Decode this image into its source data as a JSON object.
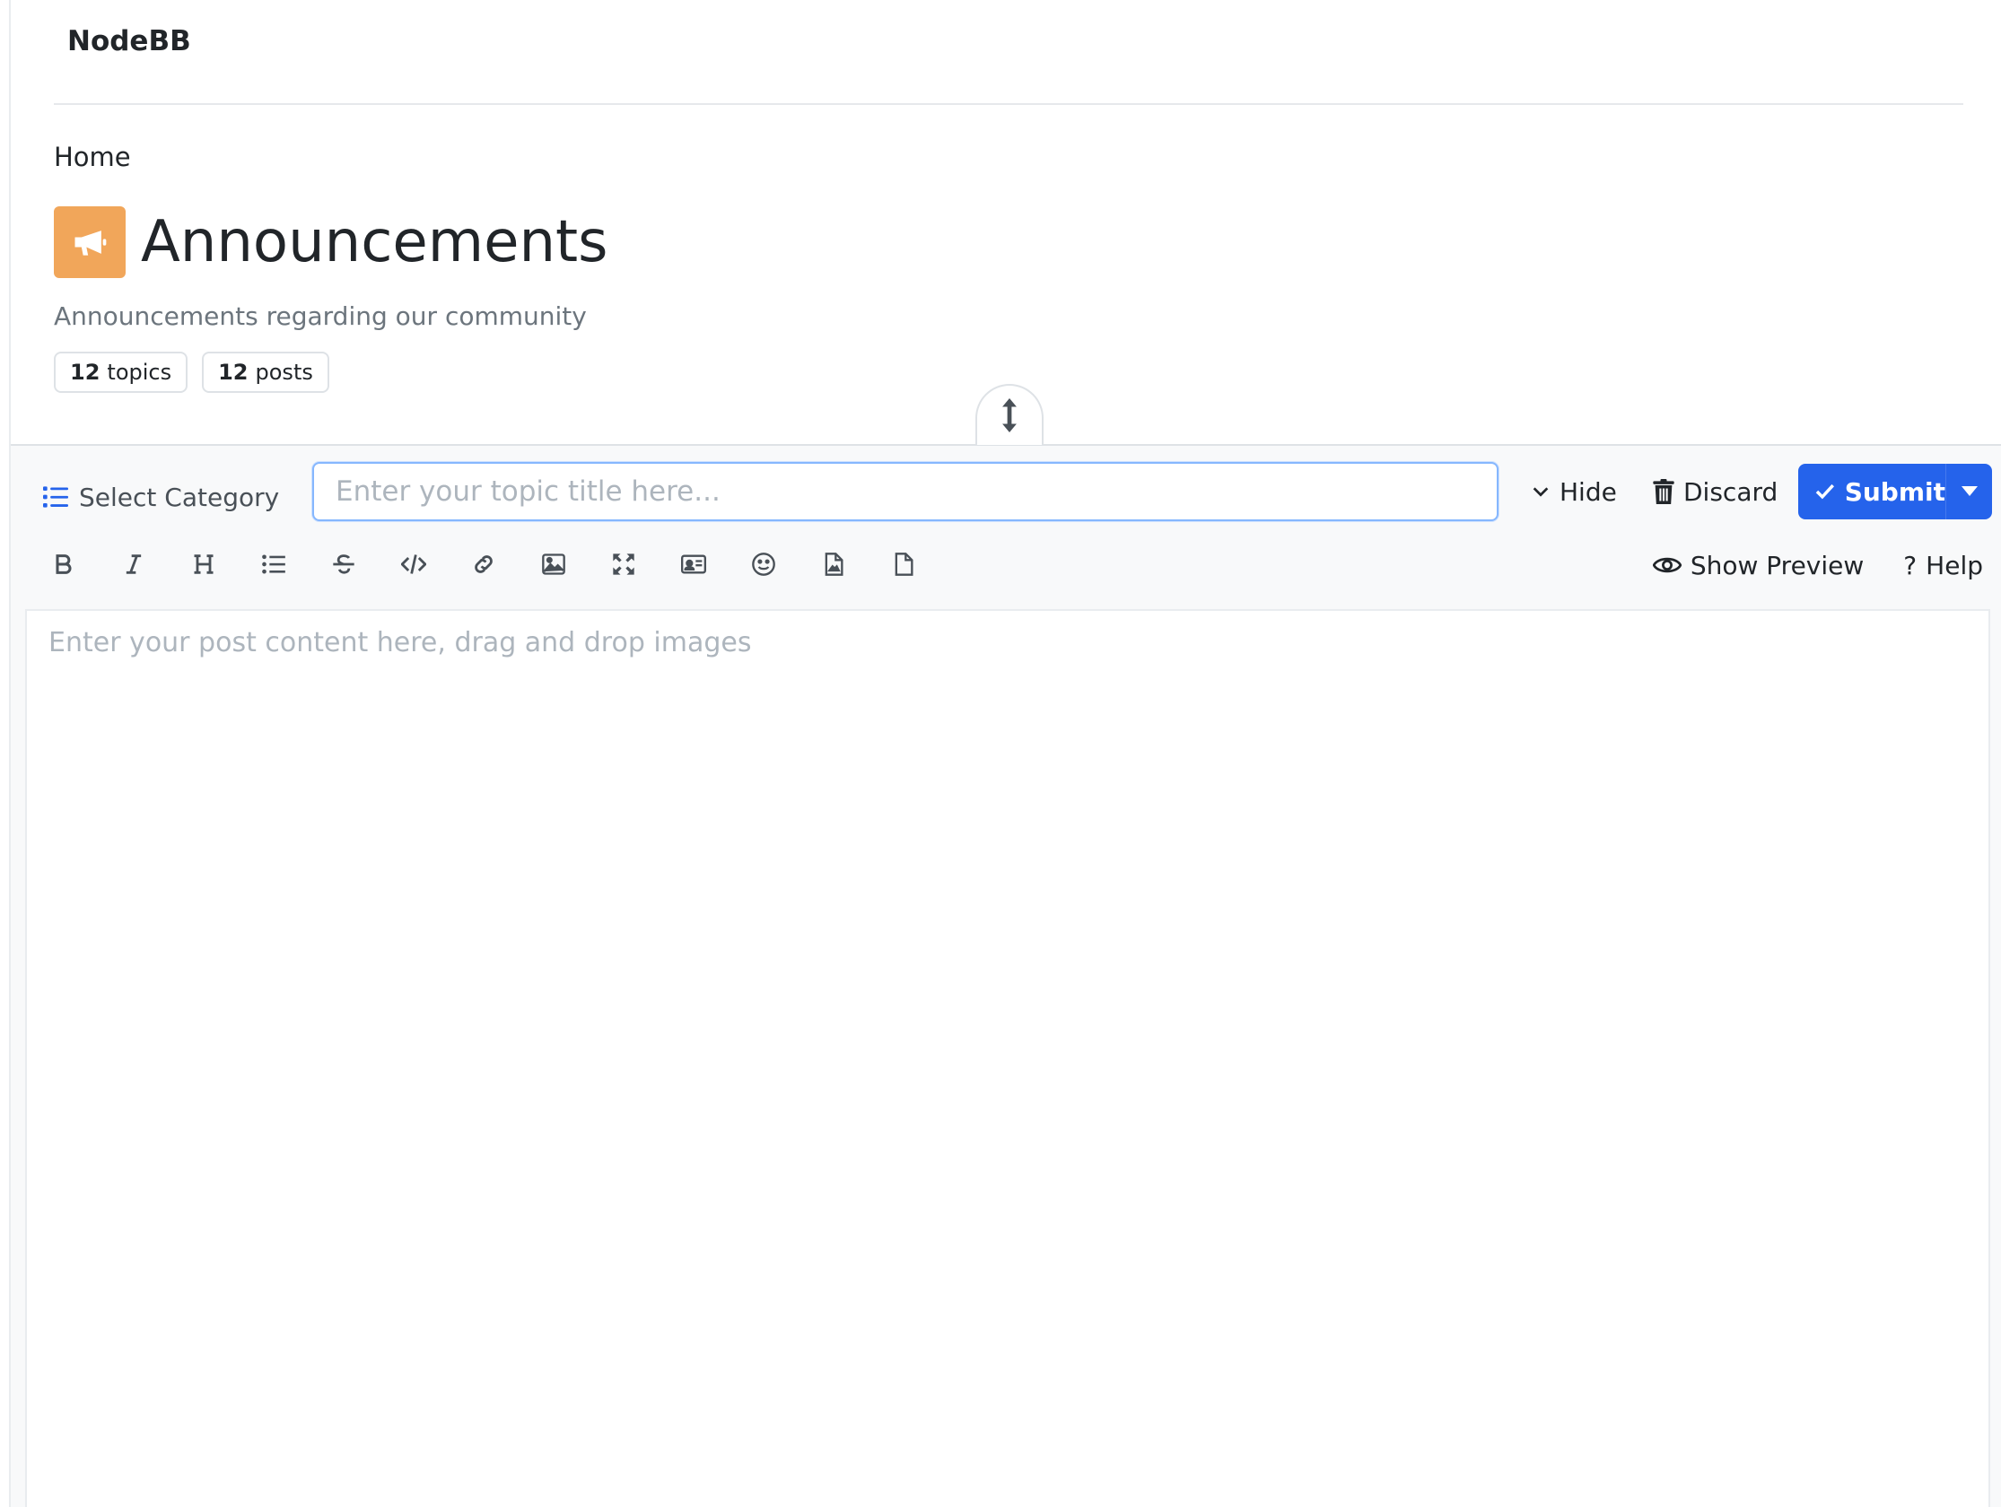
{
  "header": {
    "brand": "NodeBB"
  },
  "breadcrumb": {
    "home": "Home"
  },
  "category": {
    "title": "Announcements",
    "description": "Announcements regarding our community",
    "icon": "bullhorn-icon",
    "icon_color": "#f1a65a",
    "stats": [
      {
        "count": "12",
        "label": "topics"
      },
      {
        "count": "12",
        "label": "posts"
      }
    ]
  },
  "composer": {
    "category_select_label": "Select Category",
    "title_placeholder": "Enter your topic title here...",
    "hide_label": "Hide",
    "discard_label": "Discard",
    "submit_label": "Submit",
    "submit_color": "#2563eb",
    "content_placeholder": "Enter your post content here, drag and drop images",
    "toolbar": [
      "bold-icon",
      "italic-icon",
      "heading-icon",
      "list-icon",
      "strikethrough-icon",
      "code-icon",
      "link-icon",
      "image-icon",
      "zen-mode-icon",
      "user-card-icon",
      "emoji-icon",
      "file-image-icon",
      "file-icon"
    ],
    "show_preview_label": "Show Preview",
    "help_label": "Help"
  }
}
